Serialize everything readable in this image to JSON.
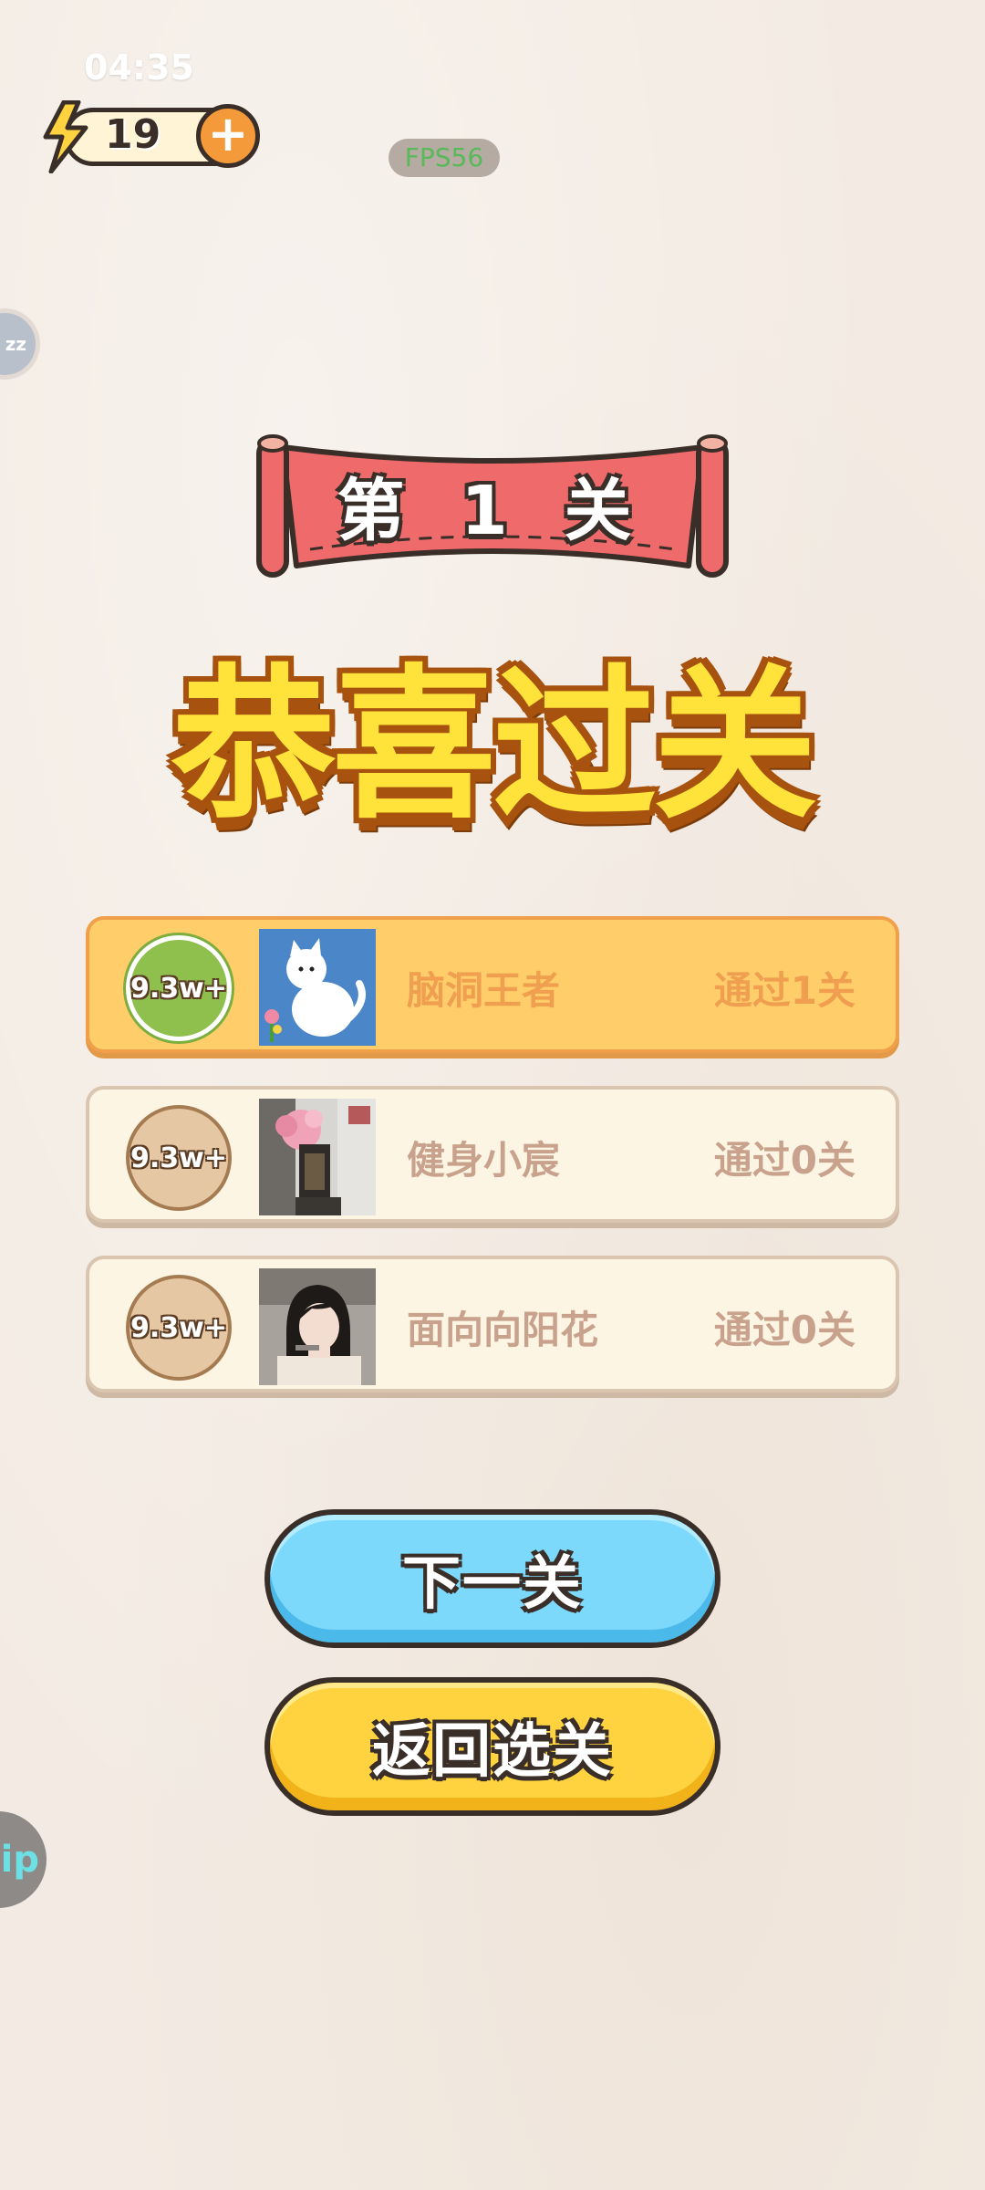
{
  "status_bar": {
    "time": "04:35"
  },
  "energy": {
    "count": "19",
    "plus_label": "+"
  },
  "fps": "FPS56",
  "side_left_top_label": "zz",
  "side_left_bottom_label": "ip",
  "level_banner": "第 1 关",
  "congrats_title": "恭喜过关",
  "ranking": [
    {
      "badge": "9.3w+",
      "name": "脑洞王者",
      "progress": "通过1关",
      "avatar_icon": "white-cat-avatar",
      "highlight": true
    },
    {
      "badge": "9.3w+",
      "name": "健身小宸",
      "progress": "通过0关",
      "avatar_icon": "flower-photo-avatar",
      "highlight": false
    },
    {
      "badge": "9.3w+",
      "name": "面向向阳花",
      "progress": "通过0关",
      "avatar_icon": "girl-photo-avatar",
      "highlight": false
    }
  ],
  "buttons": {
    "next": "下一关",
    "back": "返回选关"
  },
  "colors": {
    "background": "#f3ebe3",
    "banner_red": "#ef6b6b",
    "title_yellow": "#ffe23a",
    "next_button": "#7dd9fb",
    "back_button": "#ffd23f",
    "highlight_card": "#ffcd6a"
  }
}
